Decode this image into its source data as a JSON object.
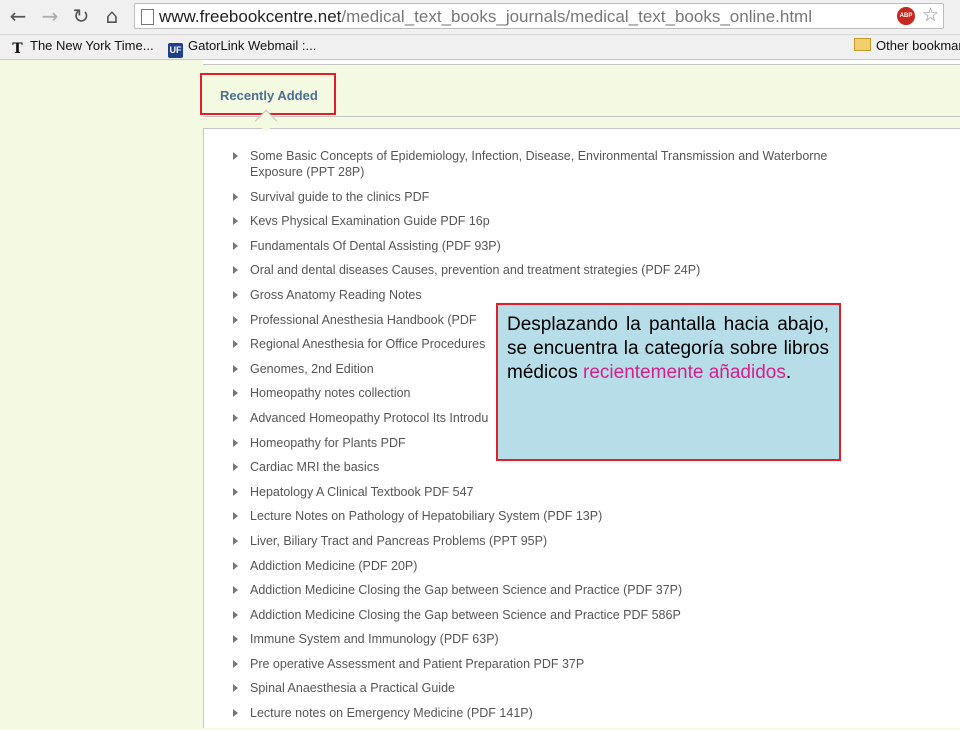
{
  "browser": {
    "url_host": "www.freebookcentre.net",
    "url_path": "/medical_text_books_journals/medical_text_books_online.html",
    "abp_label": "ABP",
    "icons": {
      "back": "back-arrow-icon",
      "forward": "forward-arrow-icon",
      "reload": "reload-icon",
      "home": "home-icon",
      "star": "star-icon"
    },
    "bookmarks": [
      {
        "label": "The New York Time...",
        "icon": "nyt-icon",
        "icon_text": "T"
      },
      {
        "label": "GatorLink Webmail :...",
        "icon": "uf-icon",
        "icon_text": "UF"
      },
      {
        "label": "Other bookmarks",
        "icon": "folder-icon",
        "icon_text": ""
      }
    ]
  },
  "section": {
    "tab_label": "Recently Added",
    "items": [
      "Some Basic Concepts of Epidemiology, Infection, Disease, Environmental Transmission and Waterborne Exposure (PPT 28P)",
      "Survival guide to the clinics PDF",
      "Kevs Physical Examination Guide PDF 16p",
      "Fundamentals Of Dental Assisting (PDF 93P)",
      "Oral and dental diseases Causes, prevention and treatment strategies (PDF 24P)",
      "Gross Anatomy Reading Notes",
      "Professional Anesthesia Handbook (PDF",
      "Regional Anesthesia for Office Procedures",
      "Genomes, 2nd Edition",
      "Homeopathy notes collection",
      "Advanced Homeopathy Protocol Its Introdu",
      "Homeopathy for Plants PDF",
      "Cardiac MRI the basics",
      "Hepatology A Clinical Textbook PDF 547",
      "Lecture Notes on Pathology of Hepatobiliary System (PDF 13P)",
      "Liver, Biliary Tract and Pancreas Problems (PPT 95P)",
      "Addiction Medicine (PDF 20P)",
      "Addiction Medicine Closing the Gap between Science and Practice (PDF 37P)",
      "Addiction Medicine Closing the Gap between Science and Practice PDF 586P",
      "Immune System and Immunology (PDF 63P)",
      "Pre operative Assessment and Patient Preparation PDF 37P",
      "Spinal Anaesthesia a Practical Guide",
      "Lecture notes on Emergency Medicine (PDF 141P)"
    ]
  },
  "annotation": {
    "text_main": "Desplazando la pantalla hacia abajo, se encuentra la categoría sobre libros médicos ",
    "text_highlight": "recientemente añadidos",
    "text_end": ".",
    "highlight_color": "#d61f8b",
    "border_color": "#e01f2a",
    "background": "#b7dde8"
  }
}
